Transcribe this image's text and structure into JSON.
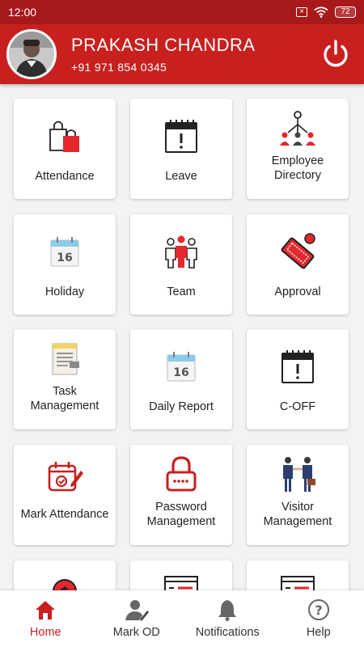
{
  "status_bar": {
    "time": "12:00",
    "battery": "72"
  },
  "user": {
    "name": "PRAKASH CHANDRA",
    "phone": "+91 971 854 0345"
  },
  "tiles": [
    {
      "label": "Attendance",
      "icon": "shopping-bags-icon"
    },
    {
      "label": "Leave",
      "icon": "calendar-alert-icon"
    },
    {
      "label": "Employee Directory",
      "icon": "org-chart-icon"
    },
    {
      "label": "Holiday",
      "icon": "calendar-16-icon"
    },
    {
      "label": "Team",
      "icon": "team-icon"
    },
    {
      "label": "Approval",
      "icon": "approval-stamp-icon"
    },
    {
      "label": "Task Management",
      "icon": "task-notepad-icon"
    },
    {
      "label": "Daily Report",
      "icon": "calendar-16-icon"
    },
    {
      "label": "C-OFF",
      "icon": "calendar-alert-icon"
    },
    {
      "label": "Mark Attendance",
      "icon": "calendar-edit-icon"
    },
    {
      "label": "Password Management",
      "icon": "padlock-icon"
    },
    {
      "label": "Visitor Management",
      "icon": "handshake-icon"
    },
    {
      "label": "",
      "icon": "dollar-icon"
    },
    {
      "label": "",
      "icon": "list-document-icon"
    },
    {
      "label": "",
      "icon": "list-document-icon"
    }
  ],
  "nav": [
    {
      "label": "Home",
      "icon": "home-icon",
      "active": true
    },
    {
      "label": "Mark OD",
      "icon": "user-edit-icon",
      "active": false
    },
    {
      "label": "Notifications",
      "icon": "bell-icon",
      "active": false
    },
    {
      "label": "Help",
      "icon": "help-icon",
      "active": false
    }
  ],
  "colors": {
    "primary": "#c8201f",
    "status_bar": "#a8191c"
  }
}
